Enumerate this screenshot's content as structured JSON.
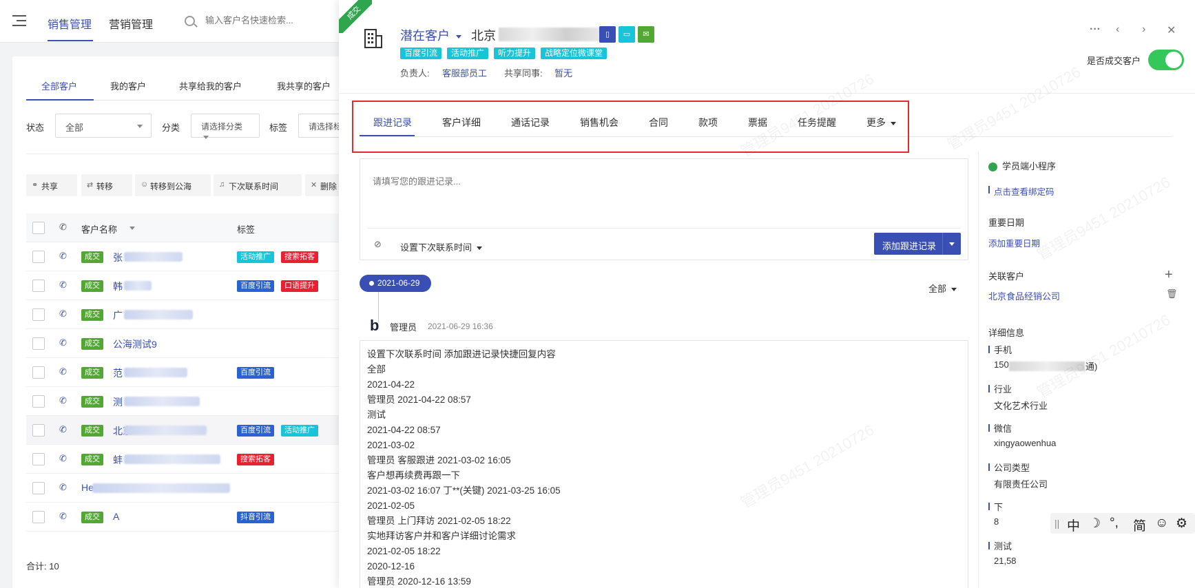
{
  "topbar": {
    "nav_tabs": [
      "销售管理",
      "营销管理"
    ],
    "search_placeholder": "输入客户名快速检索..."
  },
  "list": {
    "sub_tabs": [
      "全部客户",
      "我的客户",
      "共享给我的客户",
      "我共享的客户"
    ],
    "filters": {
      "status_label": "状态",
      "status_value": "全部",
      "category_label": "分类",
      "category_placeholder": "请选择分类",
      "tag_label": "标签",
      "tag_placeholder": "请选择标"
    },
    "toolbar": [
      "共享",
      "转移",
      "转移到公海",
      "下次联系时间",
      "删除"
    ],
    "columns": {
      "name": "客户名称",
      "tags": "标签"
    },
    "rows": [
      {
        "badge": "成交",
        "name": "张",
        "tags": [
          {
            "text": "活动推广",
            "color": "cyan"
          },
          {
            "text": "搜索拓客",
            "color": "red"
          }
        ]
      },
      {
        "badge": "成交",
        "name": "韩",
        "tags": [
          {
            "text": "百度引流",
            "color": "blue"
          },
          {
            "text": "口语提升",
            "color": "red"
          }
        ]
      },
      {
        "badge": "成交",
        "name": "广",
        "tags": []
      },
      {
        "badge": "成交",
        "name": "公海测试9",
        "tags": []
      },
      {
        "badge": "成交",
        "name": "范",
        "tags": [
          {
            "text": "百度引流",
            "color": "blue"
          }
        ]
      },
      {
        "badge": "成交",
        "name": "测",
        "tags": []
      },
      {
        "badge": "成交",
        "name": "北京",
        "tags": [
          {
            "text": "百度引流",
            "color": "blue"
          },
          {
            "text": "活动推广",
            "color": "cyan"
          }
        ]
      },
      {
        "badge": "成交",
        "name": "蚌",
        "tags": [
          {
            "text": "搜索拓客",
            "color": "red"
          }
        ]
      },
      {
        "badge": "",
        "name": "He",
        "tags": []
      },
      {
        "badge": "成交",
        "name": "A",
        "tags": [
          {
            "text": "抖音引流",
            "color": "blue"
          }
        ]
      }
    ],
    "total_label": "合计:",
    "total_value": "10"
  },
  "drawer": {
    "ribbon": "成交",
    "customer_type": "潜在客户",
    "customer_name": "北京",
    "tags": [
      "百度引流",
      "活动推广",
      "听力提升",
      "战略定位微课堂"
    ],
    "owner_label": "负责人:",
    "owner_value": "客服部员工",
    "share_label": "共享同事:",
    "share_value": "暂无",
    "deal_toggle_label": "是否成交客户",
    "deal_toggle_on": true,
    "tabs": [
      "跟进记录",
      "客户详细",
      "通话记录",
      "销售机会",
      "合同",
      "款项",
      "票据",
      "任务提醒",
      "更多"
    ],
    "active_tab": "跟进记录",
    "editor_placeholder": "请填写您的跟进记录...",
    "next_contact_label": "设置下次联系时间",
    "add_button": "添加跟进记录",
    "date_pill": "2021-06-29",
    "filter_all": "全部",
    "record": {
      "author": "管理员",
      "timestamp": "2021-06-29 16:36",
      "lines": [
        "设置下次联系时间 添加跟进记录快捷回复内容",
        "全部",
        "2021-04-22",
        "管理员 2021-04-22 08:57",
        "测试",
        "2021-04-22 08:57",
        "2021-03-02",
        "管理员 客服跟进 2021-03-02 16:05",
        "客户想再续费再跟一下",
        "2021-03-02 16:07 丁**(关键) 2021-03-25 16:05",
        "2021-02-05",
        "管理员 上门拜访 2021-02-05 18:22",
        "实地拜访客户并和客户详细讨论需求",
        "2021-02-05 18:22",
        "2020-12-16",
        "管理员 2020-12-16 13:59"
      ]
    },
    "sidebar": {
      "mini_program": "学员端小程序",
      "bind_link": "点击查看绑定码",
      "important_date_title": "重要日期",
      "important_date_link": "添加重要日期",
      "related_title": "关联客户",
      "related_link": "北京食品经销公司",
      "detail_title": "详细信息",
      "fields": [
        {
          "label": "手机",
          "value": "150"
        },
        {
          "label": "行业",
          "value": "文化艺术行业"
        },
        {
          "label": "微信",
          "value": "xingyaowenhua"
        },
        {
          "label": "公司类型",
          "value": "有限责任公司"
        },
        {
          "label": "下",
          "value": "8"
        },
        {
          "label": "测试",
          "value": "21,58"
        }
      ],
      "phone_suffix": "通)"
    }
  },
  "ime": [
    "中",
    "☽",
    "°,",
    "简",
    "☺",
    "⚙"
  ],
  "watermark": "管理员9451 20210726",
  "colors": {
    "accent": "#3a4fb3",
    "deal_green": "#52a832",
    "cyan_tag": "#19c3d8",
    "red_tag": "#e8202f",
    "blue_tag": "#2a62d4",
    "highlight_box": "#e32b2b"
  }
}
